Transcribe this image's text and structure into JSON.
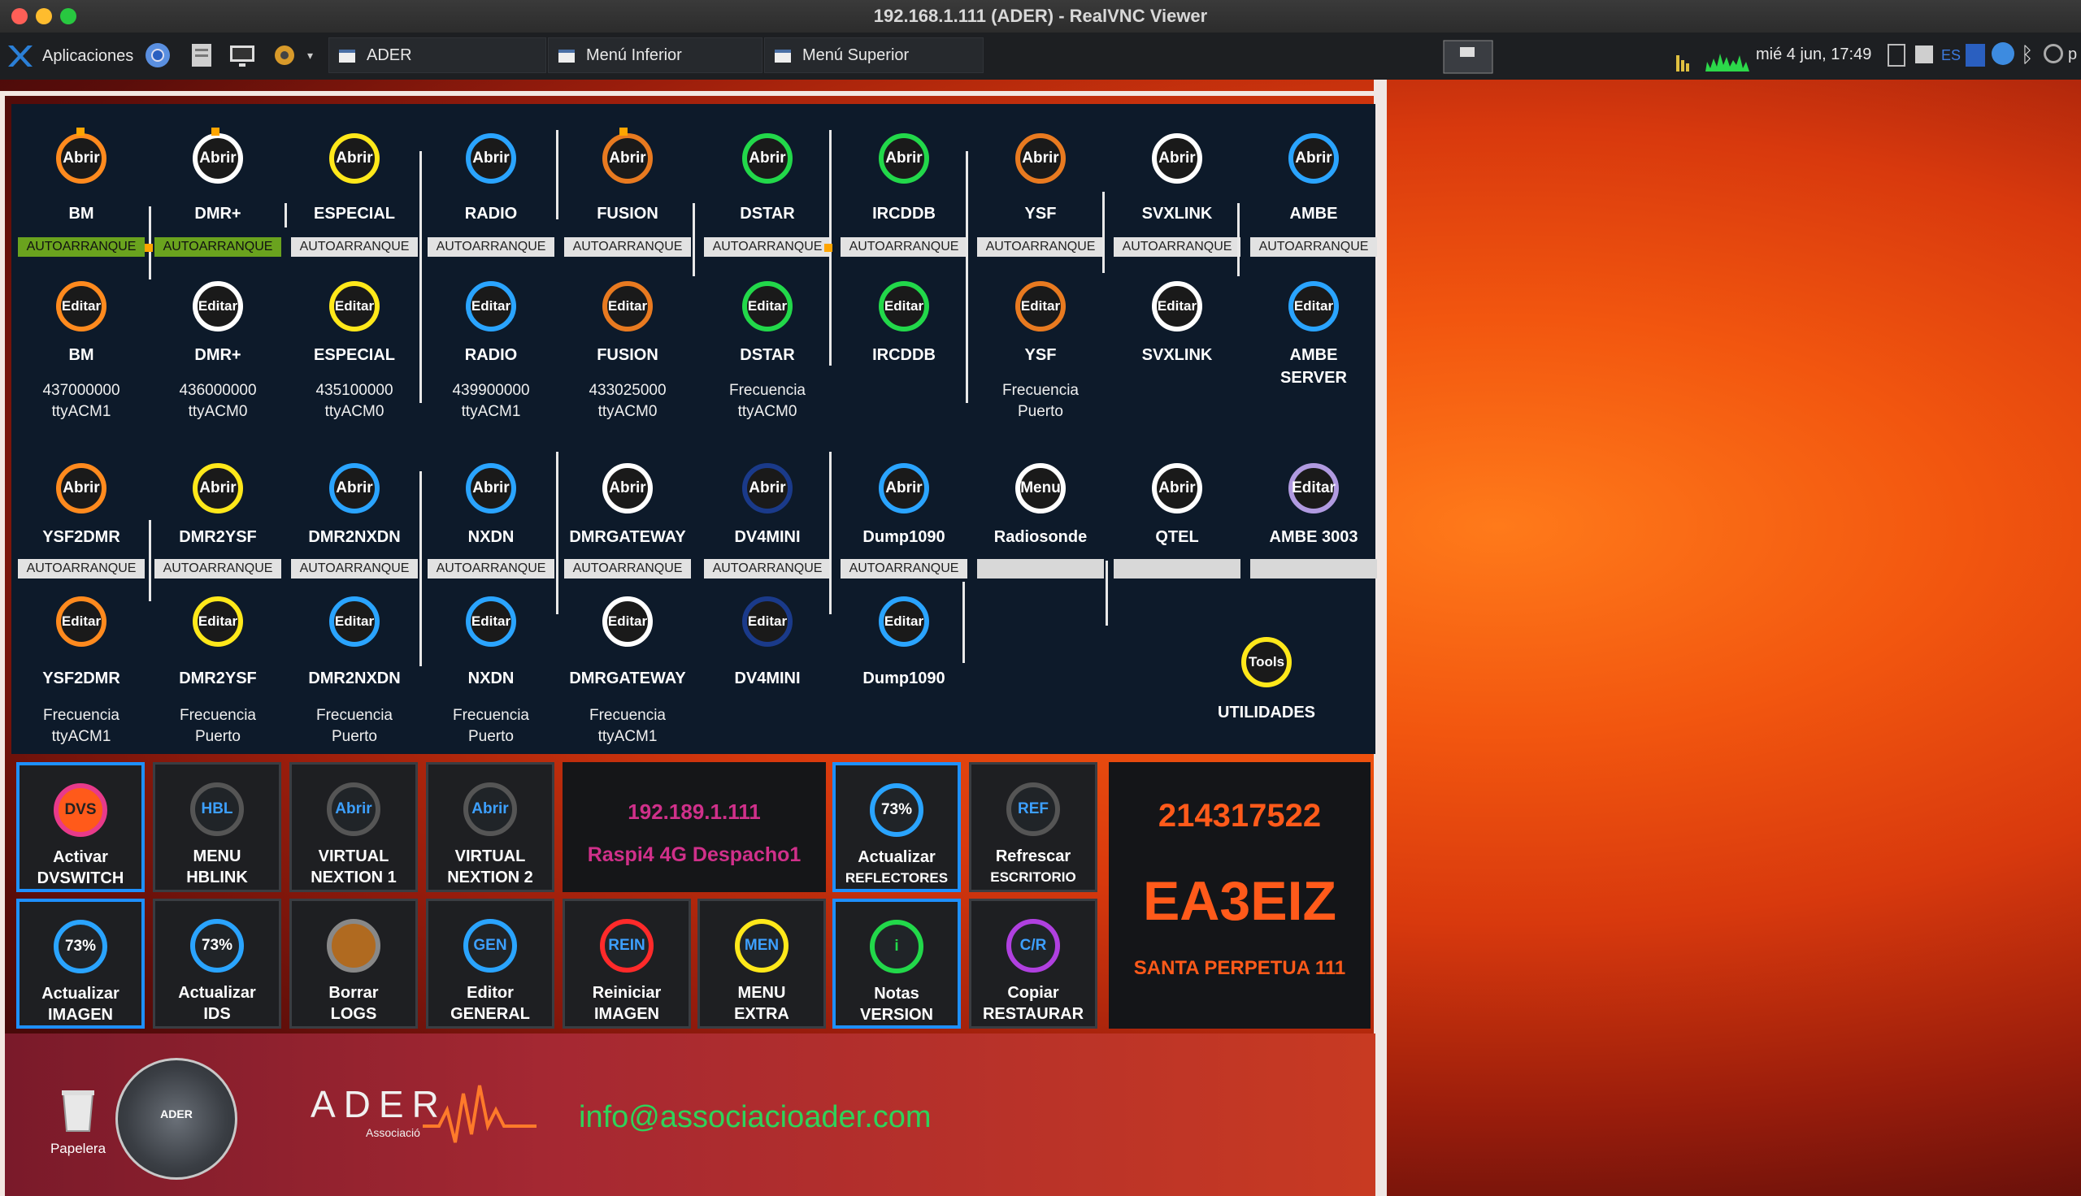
{
  "window": {
    "title": "192.168.1.111 (ADER) - RealVNC Viewer"
  },
  "taskbar": {
    "apps_label": "Aplicaciones",
    "tasks": [
      "ADER",
      "Menú Inferior",
      "Menú Superior"
    ],
    "clock": "mié  4 jun, 17:49",
    "lang": "ES",
    "tray_letter": "p"
  },
  "row1": [
    {
      "open": "Abrir",
      "name": "BM",
      "auto": "AUTOARRANQUE",
      "auto_on": true,
      "edit": "Editar",
      "ename": "BM",
      "l1": "437000000",
      "l2": "ttyACM1",
      "color": "#ff8a1e"
    },
    {
      "open": "Abrir",
      "name": "DMR+",
      "auto": "AUTOARRANQUE",
      "auto_on": true,
      "edit": "Editar",
      "ename": "DMR+",
      "l1": "436000000",
      "l2": "ttyACM0",
      "color": "#ffffff"
    },
    {
      "open": "Abrir",
      "name": "ESPECIAL",
      "auto": "AUTOARRANQUE",
      "auto_on": false,
      "edit": "Editar",
      "ename": "ESPECIAL",
      "l1": "435100000",
      "l2": "ttyACM0",
      "color": "#ffe81a"
    },
    {
      "open": "Abrir",
      "name": "RADIO",
      "auto": "AUTOARRANQUE",
      "auto_on": false,
      "edit": "Editar",
      "ename": "RADIO",
      "l1": "439900000",
      "l2": "ttyACM1",
      "color": "#2aa4ff"
    },
    {
      "open": "Abrir",
      "name": "FUSION",
      "auto": "AUTOARRANQUE",
      "auto_on": false,
      "edit": "Editar",
      "ename": "FUSION",
      "l1": "433025000",
      "l2": "ttyACM0",
      "color": "#e87a20"
    },
    {
      "open": "Abrir",
      "name": "DSTAR",
      "auto": "AUTOARRANQUE",
      "auto_on": false,
      "edit": "Editar",
      "ename": "DSTAR",
      "l1": "Frecuencia",
      "l2": "ttyACM0",
      "color": "#22d84a"
    },
    {
      "open": "Abrir",
      "name": "IRCDDB",
      "auto": "AUTOARRANQUE",
      "auto_on": false,
      "edit": "Editar",
      "ename": "IRCDDB",
      "l1": "",
      "l2": "",
      "color": "#22d84a"
    },
    {
      "open": "Abrir",
      "name": "YSF",
      "auto": "AUTOARRANQUE",
      "auto_on": false,
      "edit": "Editar",
      "ename": "YSF",
      "l1": "Frecuencia",
      "l2": "Puerto",
      "color": "#e87a20"
    },
    {
      "open": "Abrir",
      "name": "SVXLINK",
      "auto": "AUTOARRANQUE",
      "auto_on": false,
      "edit": "Editar",
      "ename": "SVXLINK",
      "l1": "",
      "l2": "",
      "color": "#ffffff"
    },
    {
      "open": "Abrir",
      "name": "AMBE",
      "auto": "AUTOARRANQUE",
      "auto_on": false,
      "edit": "Editar",
      "ename": "AMBE",
      "ename2": "SERVER",
      "l1": "",
      "l2": "",
      "color": "#2aa4ff"
    }
  ],
  "row2": [
    {
      "open": "Abrir",
      "name": "YSF2DMR",
      "auto": "AUTOARRANQUE",
      "edit": "Editar",
      "ename": "YSF2DMR",
      "l1": "Frecuencia",
      "l2": "ttyACM1",
      "color": "#ff8a1e"
    },
    {
      "open": "Abrir",
      "name": "DMR2YSF",
      "auto": "AUTOARRANQUE",
      "edit": "Editar",
      "ename": "DMR2YSF",
      "l1": "Frecuencia",
      "l2": "Puerto",
      "color": "#ffe81a"
    },
    {
      "open": "Abrir",
      "name": "DMR2NXDN",
      "auto": "AUTOARRANQUE",
      "edit": "Editar",
      "ename": "DMR2NXDN",
      "l1": "Frecuencia",
      "l2": "Puerto",
      "color": "#2aa4ff"
    },
    {
      "open": "Abrir",
      "name": "NXDN",
      "auto": "AUTOARRANQUE",
      "edit": "Editar",
      "ename": "NXDN",
      "l1": "Frecuencia",
      "l2": "Puerto",
      "color": "#2aa4ff"
    },
    {
      "open": "Abrir",
      "name": "DMRGATEWAY",
      "auto": "AUTOARRANQUE",
      "edit": "Editar",
      "ename": "DMRGATEWAY",
      "l1": "Frecuencia",
      "l2": "ttyACM1",
      "color": "#ffffff"
    },
    {
      "open": "Abrir",
      "name": "DV4MINI",
      "auto": "AUTOARRANQUE",
      "edit": "Editar",
      "ename": "DV4MINI",
      "l1": "",
      "l2": "",
      "color": "#1a3a8a"
    },
    {
      "open": "Abrir",
      "name": "Dump1090",
      "auto": "AUTOARRANQUE",
      "edit": "Editar",
      "ename": "Dump1090",
      "l1": "",
      "l2": "",
      "color": "#2aa4ff"
    },
    {
      "open": "Menu",
      "name": "Radiosonde",
      "auto": "",
      "color": "#ffffff"
    },
    {
      "open": "Abrir",
      "name": "QTEL",
      "auto": "",
      "color": "#ffffff"
    },
    {
      "open": "Editar",
      "name": "AMBE 3003",
      "auto": "",
      "color": "#b09ae0"
    }
  ],
  "utilities": {
    "icon": "Tools",
    "label": "UTILIDADES"
  },
  "tiles_row1": [
    {
      "icon": "DVS",
      "l1": "Activar",
      "l2": "DVSWITCH",
      "ring": "#e83a8a",
      "fill": "#ff5a1a",
      "text": "#222",
      "sel": true
    },
    {
      "icon": "HBL",
      "l1": "MENU",
      "l2": "HBLINK",
      "ring": "#555",
      "fill": "#202428",
      "text": "#3da0ff",
      "sel": false
    },
    {
      "icon": "Abrir",
      "l1": "VIRTUAL",
      "l2": "NEXTION 1",
      "ring": "#555",
      "fill": "#202428",
      "text": "#3da0ff",
      "sel": false
    },
    {
      "icon": "Abrir",
      "l1": "VIRTUAL",
      "l2": "NEXTION 2",
      "ring": "#555",
      "fill": "#202428",
      "text": "#3da0ff",
      "sel": false
    }
  ],
  "ip_box": {
    "ip": "192.189.1.111",
    "name": "Raspi4 4G Despacho1"
  },
  "tiles_row1b": [
    {
      "icon": "73%",
      "l1": "Actualizar",
      "l2": "REFLECTORES",
      "ring": "#2aa4ff",
      "fill": "#202428",
      "text": "#fff",
      "sel": true
    },
    {
      "icon": "REF",
      "l1": "Refrescar",
      "l2": "ESCRITORIO",
      "ring": "#555",
      "fill": "#202428",
      "text": "#3da0ff",
      "sel": false
    }
  ],
  "tiles_row2": [
    {
      "icon": "73%",
      "l1": "Actualizar",
      "l2": "IMAGEN",
      "ring": "#2aa4ff",
      "fill": "#202428",
      "text": "#fff",
      "sel": true
    },
    {
      "icon": "73%",
      "l1": "Actualizar",
      "l2": "IDS",
      "ring": "#2aa4ff",
      "fill": "#202428",
      "text": "#fff",
      "sel": false
    },
    {
      "icon": "",
      "l1": "Borrar",
      "l2": "LOGS",
      "ring": "#888",
      "fill": "#b06a20",
      "text": "#fff",
      "sel": false
    },
    {
      "icon": "GEN",
      "l1": "Editor",
      "l2": "GENERAL",
      "ring": "#2aa4ff",
      "fill": "#202428",
      "text": "#3da0ff",
      "sel": false
    },
    {
      "icon": "REIN",
      "l1": "Reiniciar",
      "l2": "IMAGEN",
      "ring": "#ff2a2a",
      "fill": "#202428",
      "text": "#3da0ff",
      "sel": false
    },
    {
      "icon": "MEN",
      "l1": "MENU",
      "l2": "EXTRA",
      "ring": "#ffe81a",
      "fill": "#202428",
      "text": "#3da0ff",
      "sel": false
    },
    {
      "icon": "i",
      "l1": "Notas",
      "l2": "VERSION",
      "ring": "#22d84a",
      "fill": "#202428",
      "text": "#22d84a",
      "sel": true
    },
    {
      "icon": "C/R",
      "l1": "Copiar",
      "l2": "RESTAURAR",
      "ring": "#b040e0",
      "fill": "#202428",
      "text": "#3da0ff",
      "sel": false
    }
  ],
  "callsign": {
    "dmr_id": "214317522",
    "call": "EA3EIZ",
    "location": "SANTA PERPETUA 111"
  },
  "desktop": {
    "trash_label": "Papelera",
    "logo_text": "ADER",
    "logo_sub": "Associació",
    "seal_text": "ADER",
    "email": "info@associacioader.com"
  }
}
